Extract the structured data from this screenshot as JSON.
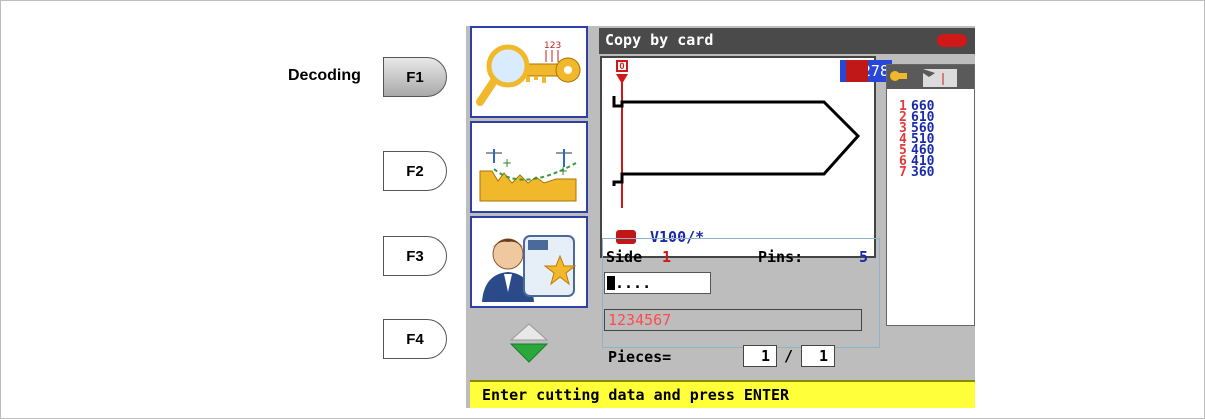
{
  "side": {
    "label": "Decoding",
    "keys": [
      "F1",
      "F2",
      "F3",
      "F4"
    ]
  },
  "screen": {
    "title": "Copy by card",
    "view": {
      "top_marker": "0",
      "value": "278",
      "key_model": "V100/*"
    },
    "pins": [
      {
        "n": "1",
        "v": "660"
      },
      {
        "n": "2",
        "v": "610"
      },
      {
        "n": "3",
        "v": "560"
      },
      {
        "n": "4",
        "v": "510"
      },
      {
        "n": "5",
        "v": "460"
      },
      {
        "n": "6",
        "v": "410"
      },
      {
        "n": "7",
        "v": "360"
      }
    ],
    "side_label": "Side",
    "side_value": "1",
    "pins_label": "Pins:",
    "pins_value": "5",
    "code_value": "....",
    "serial": "1234567",
    "pieces_label": "Pieces=",
    "pieces_current": "1",
    "pieces_separator": "/",
    "pieces_total": "1",
    "status": "Enter cutting data and press ENTER"
  },
  "colors": {
    "frame_border": "#2e3fa6",
    "status_bg": "#ffff3a",
    "value_bg": "#2747d8",
    "accent_red": "#e23a3a",
    "pin_blue": "#1a2aa8"
  }
}
